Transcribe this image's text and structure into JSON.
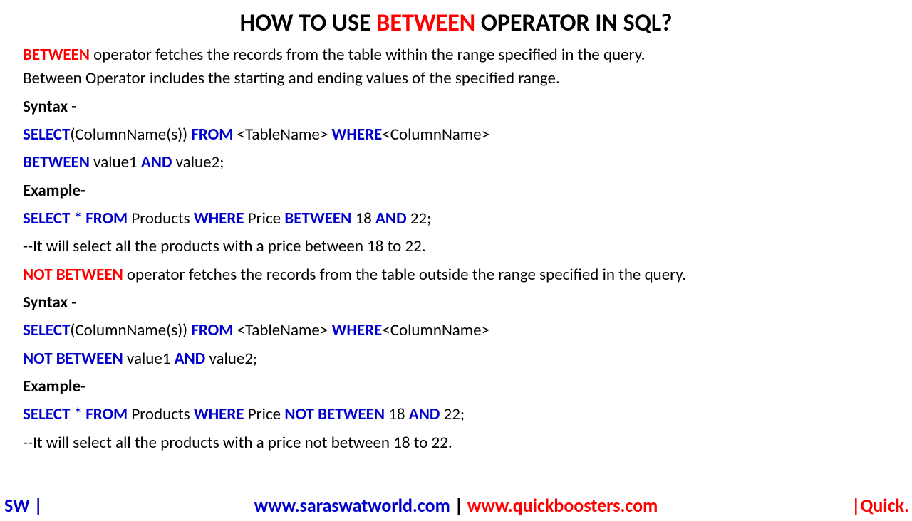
{
  "title": {
    "pre": "HOW TO USE ",
    "mid": "BETWEEN",
    "post": " OPERATOR IN SQL?"
  },
  "intro": {
    "kw": "BETWEEN",
    "rest1": " operator fetches the records from the table within the range specified in the query.",
    "rest2": "Between Operator includes the starting and ending values of the specified range."
  },
  "syntax1": {
    "label": "Syntax -",
    "l1": {
      "k1": "SELECT",
      "t1": "(ColumnName(s)) ",
      "k2": "FROM",
      "t2": " <TableName> ",
      "k3": "WHERE",
      "t3": "<ColumnName>"
    },
    "l2": {
      "k1": "BETWEEN",
      "t1": " value1 ",
      "k2": "AND",
      "t2": " value2;"
    }
  },
  "example1": {
    "label": "Example-",
    "l1": {
      "k1": "SELECT * FROM",
      "t1": " Products ",
      "k2": "WHERE",
      "t2": " Price ",
      "k3": "BETWEEN",
      "t3": " 18 ",
      "k4": "AND",
      "t4": " 22;"
    },
    "comment": "--It will select all the products with a price between 18 to 22."
  },
  "notbetween": {
    "kw": "NOT BETWEEN",
    "rest": " operator fetches the records from the table outside the range specified in the query."
  },
  "syntax2": {
    "label": "Syntax -",
    "l1": {
      "k1": "SELECT",
      "t1": "(ColumnName(s)) ",
      "k2": "FROM",
      "t2": " <TableName> ",
      "k3": "WHERE",
      "t3": "<ColumnName>"
    },
    "l2": {
      "k1": "NOT BETWEEN",
      "t1": " value1 ",
      "k2": "AND",
      "t2": " value2;"
    }
  },
  "example2": {
    "label": "Example-",
    "l1": {
      "k1": "SELECT * FROM",
      "t1": " Products ",
      "k2": "WHERE",
      "t2": " Price ",
      "k3": "NOT BETWEEN",
      "t3": " 18 ",
      "k4": "AND",
      "t4": " 22;"
    },
    "comment": "--It will select all the products with a price not between 18 to 22."
  },
  "footer": {
    "sw": "SW |",
    "url1": "www.saraswatworld.com",
    "bar": " | ",
    "url2": "www.quickboosters.com",
    "quick": "|Quick."
  }
}
